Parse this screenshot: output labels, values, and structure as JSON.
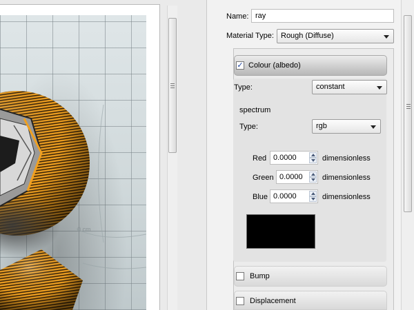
{
  "viewport": {
    "scale_label": "0 cm"
  },
  "material": {
    "name_label": "Name:",
    "name_value": "ray",
    "type_label": "Material Type:",
    "type_value": "Rough (Diffuse)"
  },
  "colour_section": {
    "title": "Colour (albedo)",
    "checked": true,
    "check_glyph": "✓",
    "type_label": "Type:",
    "type_value": "constant",
    "spectrum": {
      "heading": "spectrum",
      "type_label": "Type:",
      "type_value": "rgb",
      "channels": [
        {
          "label": "Red",
          "value": "0.0000",
          "unit": "dimensionless"
        },
        {
          "label": "Green",
          "value": "0.0000",
          "unit": "dimensionless"
        },
        {
          "label": "Blue",
          "value": "0.0000",
          "unit": "dimensionless"
        }
      ],
      "swatch_color": "#000000"
    }
  },
  "bump_section": {
    "title": "Bump",
    "checked": false
  },
  "displacement_section": {
    "title": "Displacement",
    "checked": false
  },
  "colors": {
    "sphere_orange": "#e8961c",
    "sphere_dark": "#3a2a10"
  }
}
